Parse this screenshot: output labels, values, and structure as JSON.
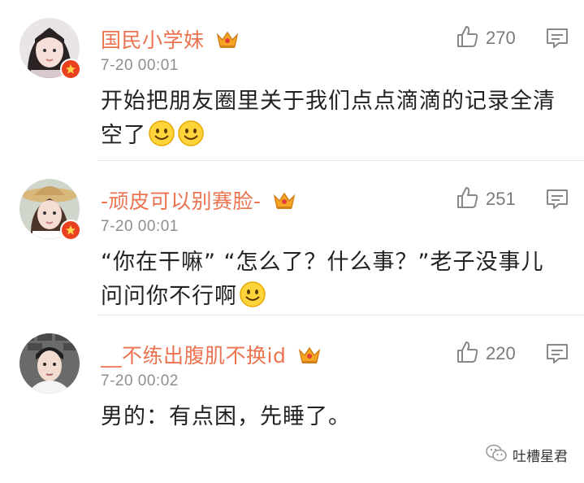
{
  "comments": [
    {
      "username": "国民小学妹",
      "timestamp": "7-20 00:01",
      "likes": "270",
      "text": "开始把朋友圈里关于我们点点滴滴的记录全清空了",
      "emoji_count": 2
    },
    {
      "username": "-顽皮可以别赛脸-",
      "timestamp": "7-20 00:01",
      "likes": "251",
      "text": "“你在干嘛” “怎么了？什么事？”老子没事儿问问你不行啊",
      "emoji_count": 1
    },
    {
      "username": "__不练出腹肌不换id",
      "timestamp": "7-20 00:02",
      "likes": "220",
      "text": "男的：有点困，先睡了。",
      "emoji_count": 0
    }
  ],
  "watermark": {
    "text": "吐槽星君"
  },
  "colors": {
    "username": "#eb7350",
    "timestamp": "#8e8e8e",
    "badge": "#e9411f",
    "crown": "#f5a623"
  },
  "icons": {
    "like": "thumbs-up-icon",
    "reply": "comment-icon",
    "crown": "vip-crown-icon",
    "verify": "verified-badge-icon",
    "emoji": "smile-emoji-icon"
  }
}
